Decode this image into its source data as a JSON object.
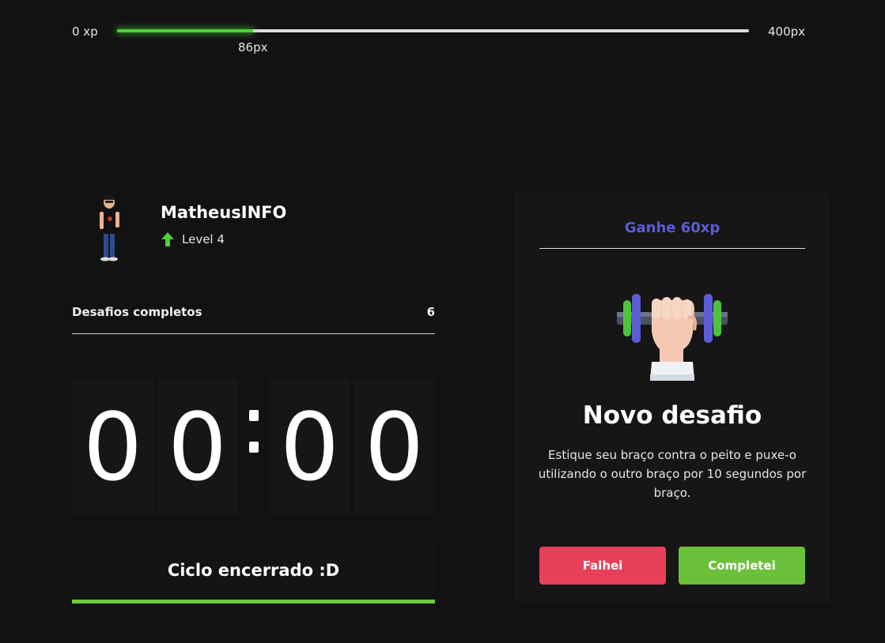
{
  "xp_bar": {
    "min_label": "0 xp",
    "max_label": "400px",
    "current_label": "86px",
    "progress_fraction": 0.215,
    "fill_color": "#4cd137"
  },
  "profile": {
    "username": "MatheusINFO",
    "level_label": "Level 4",
    "level_icon": "arrow-up-icon"
  },
  "challenges": {
    "label": "Desafios completos",
    "count": "6"
  },
  "countdown": {
    "minute_tens": "0",
    "minute_ones": "0",
    "second_tens": "0",
    "second_ones": "0"
  },
  "cycle": {
    "label": "Ciclo encerrado :D",
    "bar_color": "#6cc93b"
  },
  "challenge_card": {
    "reward": "Ganhe 60xp",
    "reward_color": "#5a5cd8",
    "image_icon": "dumbbell-arm-icon",
    "title": "Novo desafio",
    "description": "Estique seu braço contra o peito e puxe-o utilizando o outro braço por 10 segundos por braço.",
    "fail_label": "Falhei",
    "fail_color": "#e83f5b",
    "complete_label": "Completei",
    "complete_color": "#6cc13b"
  }
}
